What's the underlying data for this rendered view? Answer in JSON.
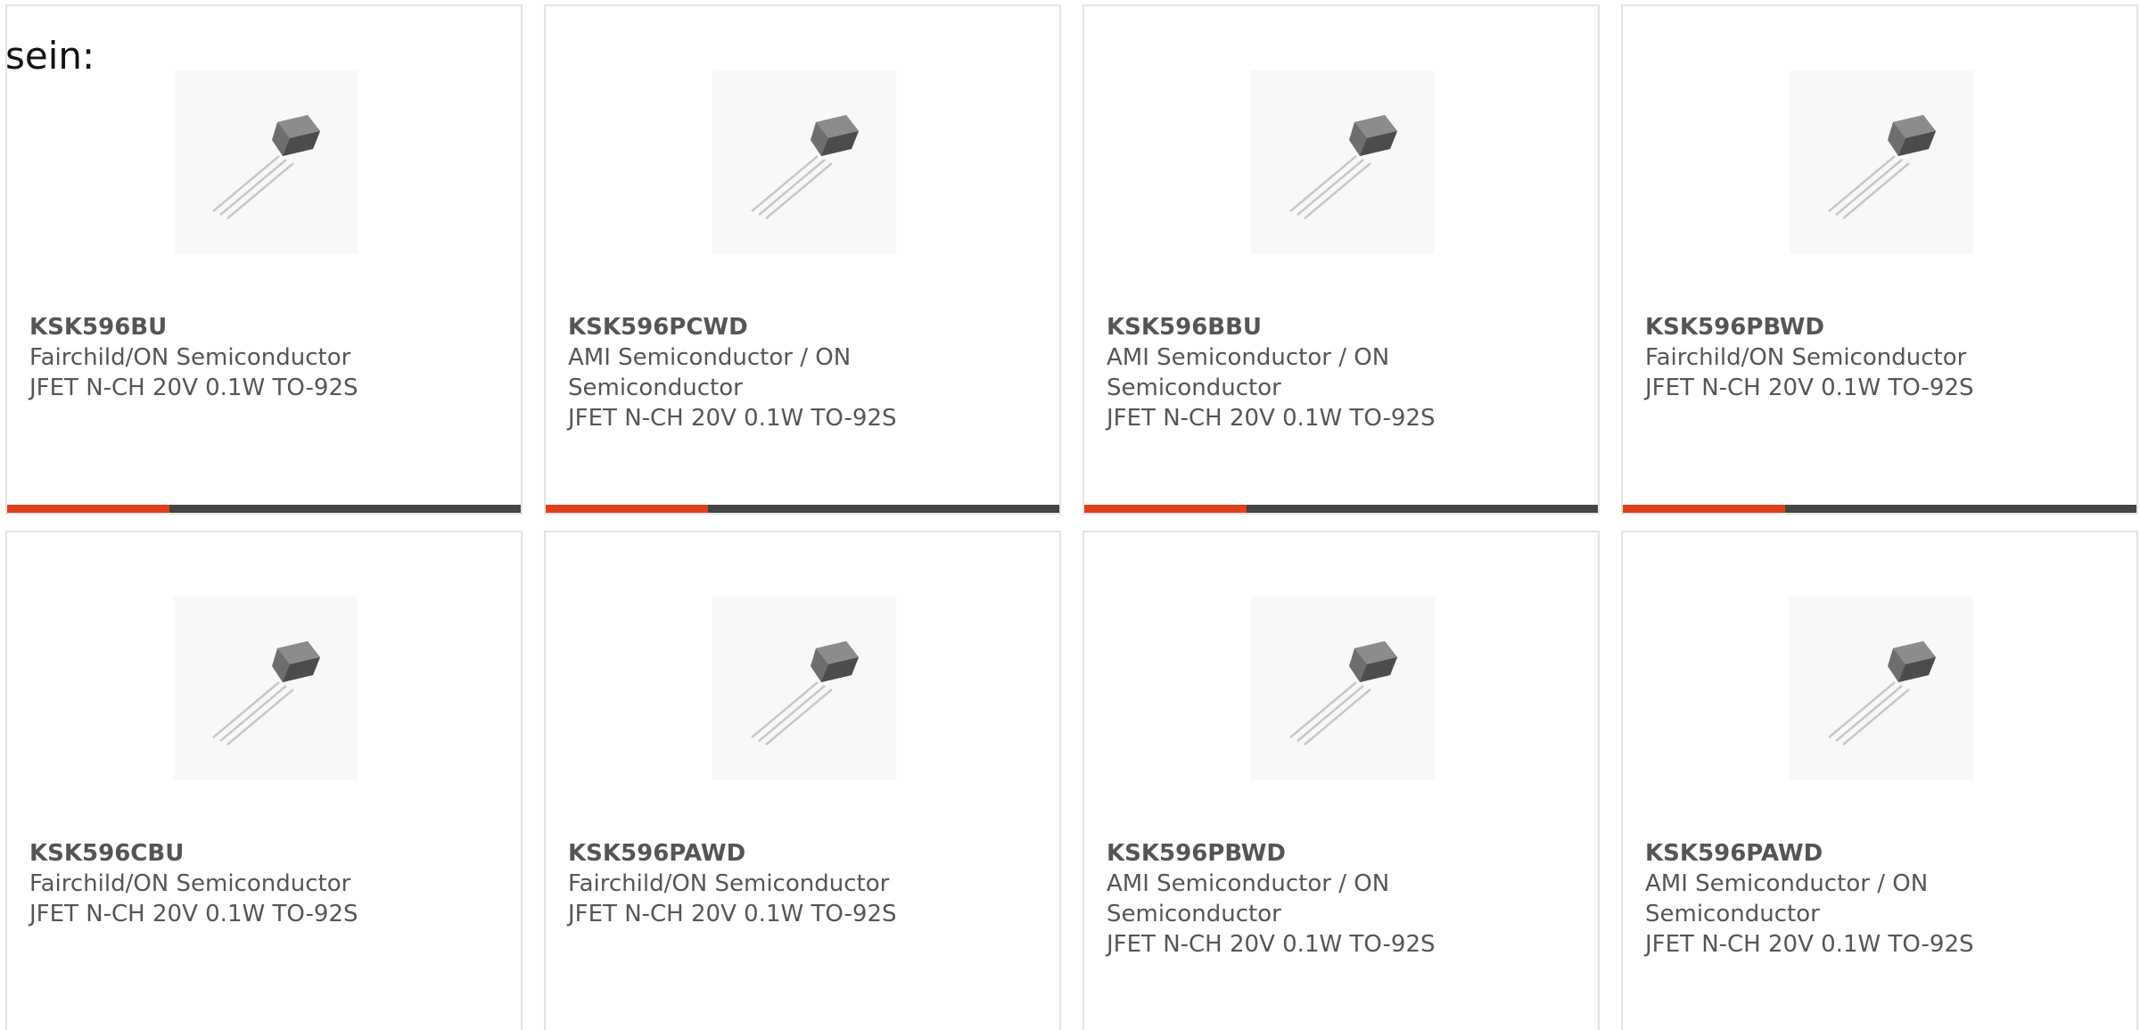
{
  "intro_text": "sein:",
  "colors": {
    "accent": "#e0401c",
    "bar_dark": "#444444",
    "text": "#555555",
    "border": "#e4e4e4"
  },
  "thumbnail_icon": "transistor-to92-icon",
  "products": [
    {
      "part": "KSK596BU",
      "manufacturer": "Fairchild/ON Semiconductor",
      "description": "JFET N-CH 20V 0.1W TO-92S"
    },
    {
      "part": "KSK596PCWD",
      "manufacturer": "AMI Semiconductor / ON Semiconductor",
      "description": "JFET N-CH 20V 0.1W TO-92S"
    },
    {
      "part": "KSK596BBU",
      "manufacturer": "AMI Semiconductor / ON Semiconductor",
      "description": "JFET N-CH 20V 0.1W TO-92S"
    },
    {
      "part": "KSK596PBWD",
      "manufacturer": "Fairchild/ON Semiconductor",
      "description": "JFET N-CH 20V 0.1W TO-92S"
    },
    {
      "part": "KSK596CBU",
      "manufacturer": "Fairchild/ON Semiconductor",
      "description": "JFET N-CH 20V 0.1W TO-92S"
    },
    {
      "part": "KSK596PAWD",
      "manufacturer": "Fairchild/ON Semiconductor",
      "description": "JFET N-CH 20V 0.1W TO-92S"
    },
    {
      "part": "KSK596PBWD",
      "manufacturer": "AMI Semiconductor / ON Semiconductor",
      "description": "JFET N-CH 20V 0.1W TO-92S"
    },
    {
      "part": "KSK596PAWD",
      "manufacturer": "AMI Semiconductor / ON Semiconductor",
      "description": "JFET N-CH 20V 0.1W TO-92S"
    }
  ]
}
